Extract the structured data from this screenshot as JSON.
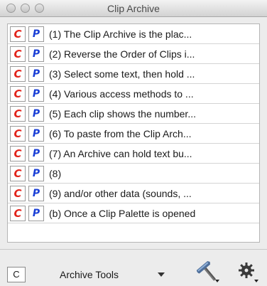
{
  "window": {
    "title": "Clip Archive"
  },
  "clips": [
    {
      "c_label": "C",
      "p_label": "P",
      "text": "(1)  The Clip Archive is the plac..."
    },
    {
      "c_label": "C",
      "p_label": "P",
      "text": "(2)  Reverse the Order of Clips i..."
    },
    {
      "c_label": "C",
      "p_label": "P",
      "text": "(3)  Select some text, then hold ..."
    },
    {
      "c_label": "C",
      "p_label": "P",
      "text": "(4)  Various access methods to ..."
    },
    {
      "c_label": "C",
      "p_label": "P",
      "text": "(5)  Each clip shows the number..."
    },
    {
      "c_label": "C",
      "p_label": "P",
      "text": "(6)  To paste from the Clip Arch..."
    },
    {
      "c_label": "C",
      "p_label": "P",
      "text": "(7)  An Archive can hold text bu..."
    },
    {
      "c_label": "C",
      "p_label": "P",
      "text": "(8)"
    },
    {
      "c_label": "C",
      "p_label": "P",
      "text": "(9)  and/or other data (sounds, ..."
    },
    {
      "c_label": "C",
      "p_label": "P",
      "text": "(b)  Once a Clip Palette is opened"
    }
  ],
  "toolbar": {
    "c_box_label": "C",
    "tools_menu_label": "Archive Tools",
    "icons": [
      "hammer-icon",
      "gear-icon"
    ]
  },
  "colors": {
    "copy_red": "#e2231a",
    "paste_blue": "#1a3fd6"
  }
}
